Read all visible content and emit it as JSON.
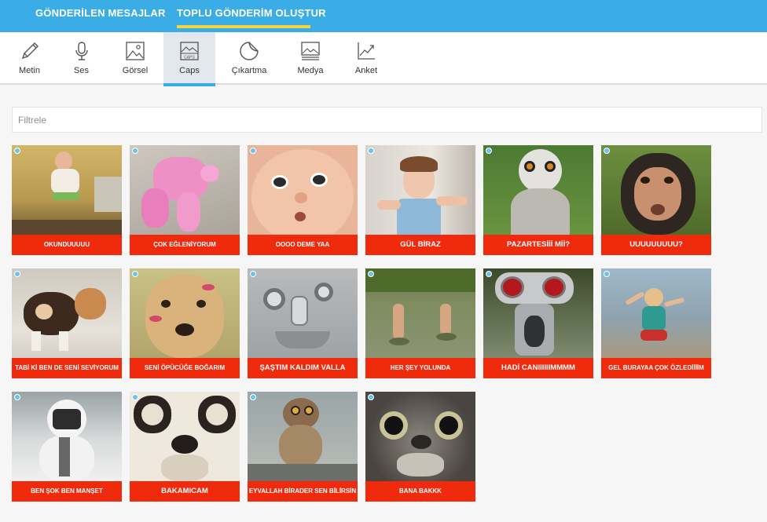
{
  "topbar": {
    "tabs": [
      {
        "label": "GÖNDERİLEN MESAJLAR",
        "active": false
      },
      {
        "label": "TOPLU GÖNDERİM OLUŞTUR",
        "active": true
      }
    ],
    "accent": "#3aace6",
    "underline_color": "#f4d33b"
  },
  "toolbar": {
    "items": [
      {
        "label": "Metin",
        "icon": "pencil-icon"
      },
      {
        "label": "Ses",
        "icon": "microphone-icon"
      },
      {
        "label": "Görsel",
        "icon": "image-icon"
      },
      {
        "label": "Caps",
        "icon": "caps-icon",
        "active": true,
        "icon_text": "CAPS"
      },
      {
        "label": "Çıkartma",
        "icon": "sticker-icon"
      },
      {
        "label": "Medya",
        "icon": "media-icon"
      },
      {
        "label": "Anket",
        "icon": "chart-icon"
      }
    ]
  },
  "filter": {
    "placeholder": "Filtrele",
    "value": ""
  },
  "caps": [
    {
      "caption": "OKUNDUUUUU"
    },
    {
      "caption": "ÇOK EĞLENİYORUM"
    },
    {
      "caption": "OOOO DEME YAA"
    },
    {
      "caption": "GÜL BİRAZ"
    },
    {
      "caption": "PAZARTESİİİ Mİİ?"
    },
    {
      "caption": "UUUUUUUUU?"
    },
    {
      "caption": "TABİ Kİ BEN DE SENİ SEVİYORUM"
    },
    {
      "caption": "SENİ ÖPÜCÜĞE BOĞARIM"
    },
    {
      "caption": "ŞAŞTIM KALDIM VALLA"
    },
    {
      "caption": "HER ŞEY YOLUNDA"
    },
    {
      "caption": "HADİ CANIIIIIIMMMM"
    },
    {
      "caption": "GEL BURAYAA ÇOK ÖZLEDİİİİM"
    },
    {
      "caption": "BEN ŞOK BEN MANŞET"
    },
    {
      "caption": "BAKAMICAM"
    },
    {
      "caption": "EYVALLAH BİRADER SEN BİLİRSİN"
    },
    {
      "caption": "BANA BAKKK"
    }
  ],
  "colors": {
    "caption_bg": "#f02b0d",
    "badge": "#6cc3ea"
  }
}
